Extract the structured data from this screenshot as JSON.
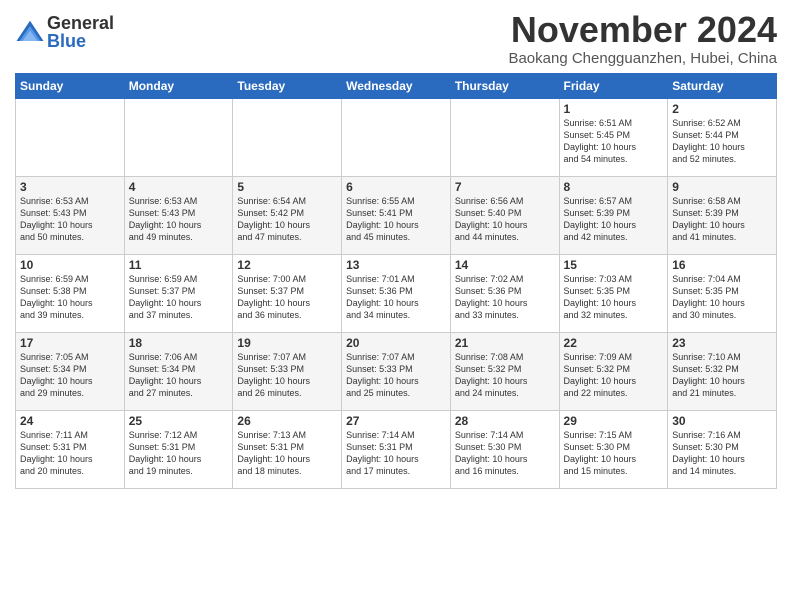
{
  "logo": {
    "general": "General",
    "blue": "Blue"
  },
  "title": "November 2024",
  "subtitle": "Baokang Chengguanzhen, Hubei, China",
  "weekdays": [
    "Sunday",
    "Monday",
    "Tuesday",
    "Wednesday",
    "Thursday",
    "Friday",
    "Saturday"
  ],
  "weeks": [
    [
      {
        "day": "",
        "info": ""
      },
      {
        "day": "",
        "info": ""
      },
      {
        "day": "",
        "info": ""
      },
      {
        "day": "",
        "info": ""
      },
      {
        "day": "",
        "info": ""
      },
      {
        "day": "1",
        "info": "Sunrise: 6:51 AM\nSunset: 5:45 PM\nDaylight: 10 hours\nand 54 minutes."
      },
      {
        "day": "2",
        "info": "Sunrise: 6:52 AM\nSunset: 5:44 PM\nDaylight: 10 hours\nand 52 minutes."
      }
    ],
    [
      {
        "day": "3",
        "info": "Sunrise: 6:53 AM\nSunset: 5:43 PM\nDaylight: 10 hours\nand 50 minutes."
      },
      {
        "day": "4",
        "info": "Sunrise: 6:53 AM\nSunset: 5:43 PM\nDaylight: 10 hours\nand 49 minutes."
      },
      {
        "day": "5",
        "info": "Sunrise: 6:54 AM\nSunset: 5:42 PM\nDaylight: 10 hours\nand 47 minutes."
      },
      {
        "day": "6",
        "info": "Sunrise: 6:55 AM\nSunset: 5:41 PM\nDaylight: 10 hours\nand 45 minutes."
      },
      {
        "day": "7",
        "info": "Sunrise: 6:56 AM\nSunset: 5:40 PM\nDaylight: 10 hours\nand 44 minutes."
      },
      {
        "day": "8",
        "info": "Sunrise: 6:57 AM\nSunset: 5:39 PM\nDaylight: 10 hours\nand 42 minutes."
      },
      {
        "day": "9",
        "info": "Sunrise: 6:58 AM\nSunset: 5:39 PM\nDaylight: 10 hours\nand 41 minutes."
      }
    ],
    [
      {
        "day": "10",
        "info": "Sunrise: 6:59 AM\nSunset: 5:38 PM\nDaylight: 10 hours\nand 39 minutes."
      },
      {
        "day": "11",
        "info": "Sunrise: 6:59 AM\nSunset: 5:37 PM\nDaylight: 10 hours\nand 37 minutes."
      },
      {
        "day": "12",
        "info": "Sunrise: 7:00 AM\nSunset: 5:37 PM\nDaylight: 10 hours\nand 36 minutes."
      },
      {
        "day": "13",
        "info": "Sunrise: 7:01 AM\nSunset: 5:36 PM\nDaylight: 10 hours\nand 34 minutes."
      },
      {
        "day": "14",
        "info": "Sunrise: 7:02 AM\nSunset: 5:36 PM\nDaylight: 10 hours\nand 33 minutes."
      },
      {
        "day": "15",
        "info": "Sunrise: 7:03 AM\nSunset: 5:35 PM\nDaylight: 10 hours\nand 32 minutes."
      },
      {
        "day": "16",
        "info": "Sunrise: 7:04 AM\nSunset: 5:35 PM\nDaylight: 10 hours\nand 30 minutes."
      }
    ],
    [
      {
        "day": "17",
        "info": "Sunrise: 7:05 AM\nSunset: 5:34 PM\nDaylight: 10 hours\nand 29 minutes."
      },
      {
        "day": "18",
        "info": "Sunrise: 7:06 AM\nSunset: 5:34 PM\nDaylight: 10 hours\nand 27 minutes."
      },
      {
        "day": "19",
        "info": "Sunrise: 7:07 AM\nSunset: 5:33 PM\nDaylight: 10 hours\nand 26 minutes."
      },
      {
        "day": "20",
        "info": "Sunrise: 7:07 AM\nSunset: 5:33 PM\nDaylight: 10 hours\nand 25 minutes."
      },
      {
        "day": "21",
        "info": "Sunrise: 7:08 AM\nSunset: 5:32 PM\nDaylight: 10 hours\nand 24 minutes."
      },
      {
        "day": "22",
        "info": "Sunrise: 7:09 AM\nSunset: 5:32 PM\nDaylight: 10 hours\nand 22 minutes."
      },
      {
        "day": "23",
        "info": "Sunrise: 7:10 AM\nSunset: 5:32 PM\nDaylight: 10 hours\nand 21 minutes."
      }
    ],
    [
      {
        "day": "24",
        "info": "Sunrise: 7:11 AM\nSunset: 5:31 PM\nDaylight: 10 hours\nand 20 minutes."
      },
      {
        "day": "25",
        "info": "Sunrise: 7:12 AM\nSunset: 5:31 PM\nDaylight: 10 hours\nand 19 minutes."
      },
      {
        "day": "26",
        "info": "Sunrise: 7:13 AM\nSunset: 5:31 PM\nDaylight: 10 hours\nand 18 minutes."
      },
      {
        "day": "27",
        "info": "Sunrise: 7:14 AM\nSunset: 5:31 PM\nDaylight: 10 hours\nand 17 minutes."
      },
      {
        "day": "28",
        "info": "Sunrise: 7:14 AM\nSunset: 5:30 PM\nDaylight: 10 hours\nand 16 minutes."
      },
      {
        "day": "29",
        "info": "Sunrise: 7:15 AM\nSunset: 5:30 PM\nDaylight: 10 hours\nand 15 minutes."
      },
      {
        "day": "30",
        "info": "Sunrise: 7:16 AM\nSunset: 5:30 PM\nDaylight: 10 hours\nand 14 minutes."
      }
    ]
  ]
}
